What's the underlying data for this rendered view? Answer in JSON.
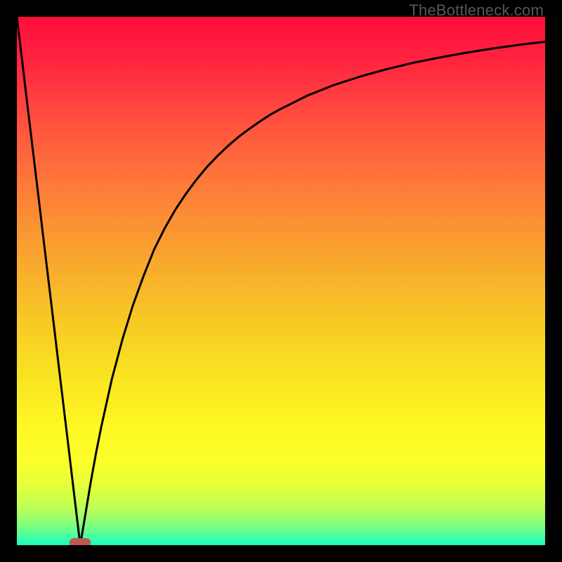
{
  "watermark": "TheBottleneck.com",
  "chart_data": {
    "type": "line",
    "title": "",
    "xlabel": "",
    "ylabel": "",
    "xlim": [
      0,
      100
    ],
    "ylim": [
      0,
      100
    ],
    "x": [
      0,
      1,
      2,
      3,
      4,
      5,
      6,
      7,
      8,
      9,
      10,
      11,
      12,
      13,
      14,
      15,
      16,
      18,
      20,
      22,
      24,
      26,
      28,
      30,
      32,
      34,
      36,
      38,
      40,
      42,
      44,
      46,
      48,
      50,
      55,
      60,
      65,
      70,
      75,
      80,
      85,
      90,
      95,
      100
    ],
    "values": [
      100,
      91.7,
      83.3,
      75.0,
      66.7,
      58.3,
      50.0,
      41.7,
      33.3,
      25.0,
      16.7,
      8.3,
      0.0,
      6.0,
      12.0,
      17.5,
      22.5,
      31.5,
      39.0,
      45.5,
      51.0,
      56.0,
      60.0,
      63.5,
      66.5,
      69.2,
      71.6,
      73.7,
      75.6,
      77.3,
      78.8,
      80.2,
      81.5,
      82.6,
      85.1,
      87.1,
      88.7,
      90.1,
      91.3,
      92.3,
      93.2,
      94.0,
      94.7,
      95.3
    ],
    "series_name": "bottleneck-percent",
    "marker_x": 12,
    "marker_y": 0,
    "gradient_stops": [
      {
        "offset": 0.0,
        "color": "#ff0d3a"
      },
      {
        "offset": 0.08,
        "color": "#ff2340"
      },
      {
        "offset": 0.18,
        "color": "#ff4a3f"
      },
      {
        "offset": 0.28,
        "color": "#fe6d3b"
      },
      {
        "offset": 0.38,
        "color": "#fb8e34"
      },
      {
        "offset": 0.48,
        "color": "#f8ad2c"
      },
      {
        "offset": 0.58,
        "color": "#f7ca25"
      },
      {
        "offset": 0.68,
        "color": "#f9e321"
      },
      {
        "offset": 0.78,
        "color": "#fef823"
      },
      {
        "offset": 0.84,
        "color": "#fbff2b"
      },
      {
        "offset": 0.88,
        "color": "#eaff37"
      },
      {
        "offset": 0.92,
        "color": "#c7ff4e"
      },
      {
        "offset": 0.95,
        "color": "#9aff6c"
      },
      {
        "offset": 0.975,
        "color": "#5fff92"
      },
      {
        "offset": 1.0,
        "color": "#17ffc0"
      }
    ]
  },
  "colors": {
    "curve": "#000000",
    "marker": "#bb5b4e",
    "frame": "#000000"
  }
}
